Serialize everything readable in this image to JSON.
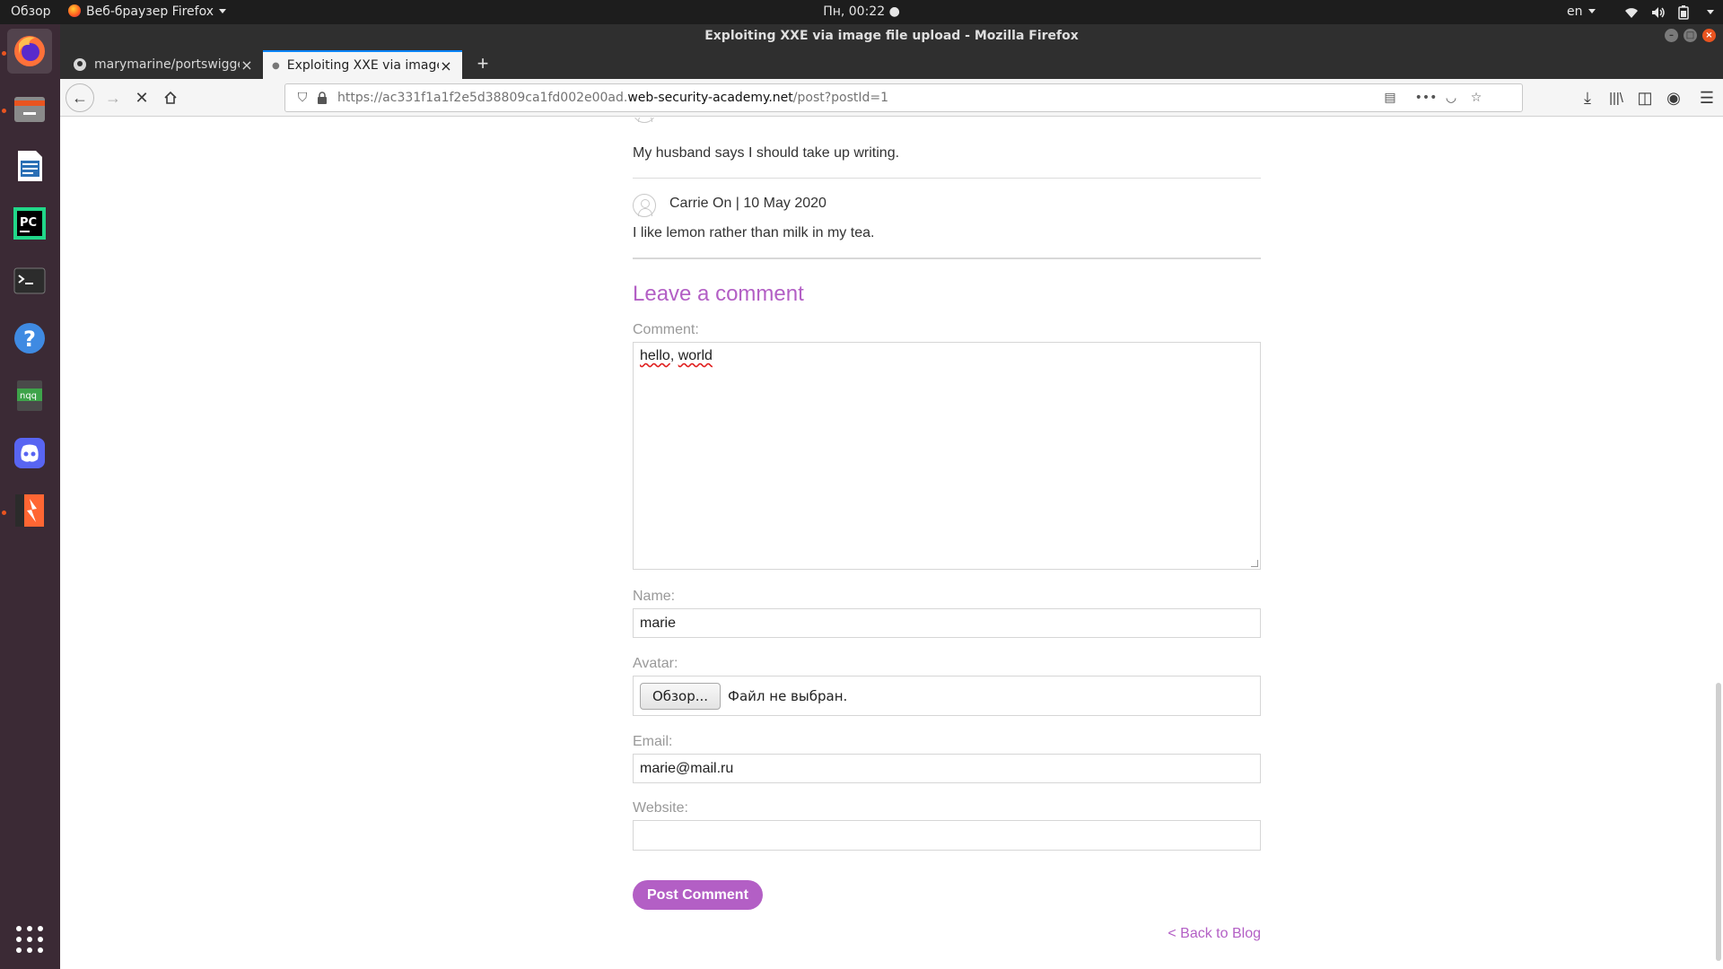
{
  "top_bar": {
    "activities": "Обзор",
    "app_menu": "Веб-браузер Firefox",
    "clock": "Пн, 00:22",
    "language": "en"
  },
  "window": {
    "title": "Exploiting XXE via image file upload - Mozilla Firefox"
  },
  "tabs": [
    {
      "title": "marymarine/portswigger"
    },
    {
      "title": "Exploiting XXE via image file upload"
    }
  ],
  "urlbar": {
    "prefix": "https://ac331f1a1f2e5d38809ca1fd002e00ad.",
    "host": "web-security-academy.net",
    "path": "/post?postId=1"
  },
  "comments": [
    {
      "text": "My husband says I should take up writing."
    },
    {
      "author_date": "Carrie On | 10 May 2020",
      "text": "I like lemon rather than milk in my tea."
    }
  ],
  "form": {
    "heading": "Leave a comment",
    "comment_label": "Comment:",
    "comment_value_1": "hello",
    "comment_value_sep": ", ",
    "comment_value_2": "world",
    "name_label": "Name:",
    "name_value": "marie",
    "avatar_label": "Avatar:",
    "browse_button": "Обзор...",
    "file_status": "Файл не выбран.",
    "email_label": "Email:",
    "email_value": "marie@mail.ru",
    "website_label": "Website:",
    "website_value": "",
    "submit": "Post Comment"
  },
  "back_link": "< Back to Blog",
  "colors": {
    "accent": "#b35fc5",
    "dock_bg": "#3b2a35",
    "ubuntu_orange": "#e95420"
  }
}
